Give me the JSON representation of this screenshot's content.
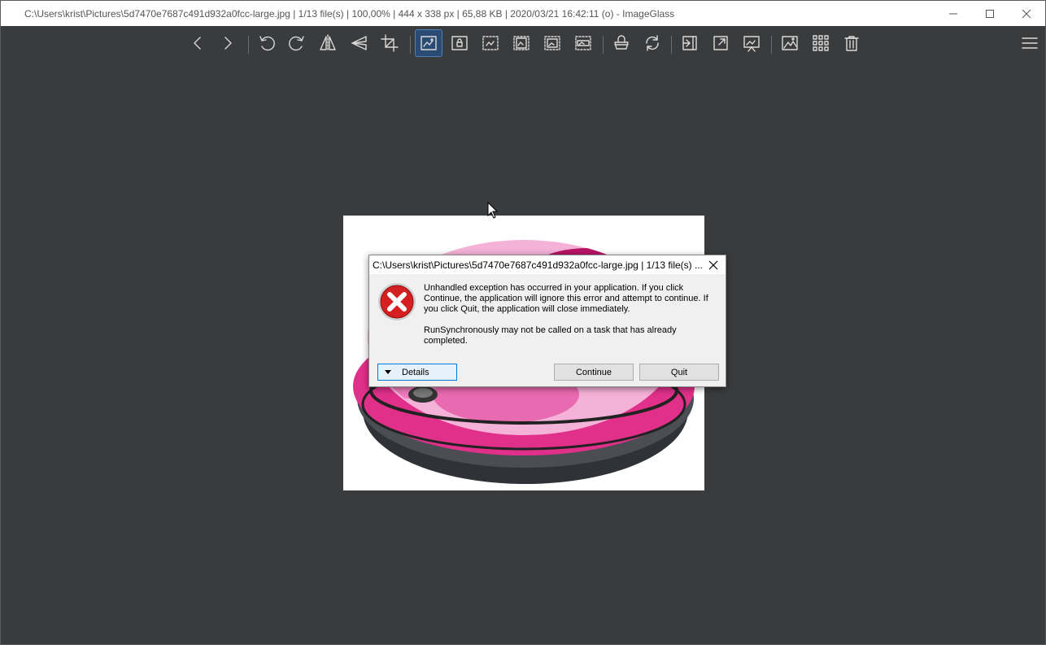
{
  "window": {
    "title": "C:\\Users\\krist\\Pictures\\5d7470e7687c491d932a0fcc-large.jpg  |  1/13 file(s)  |  100,00%  |  444 x 338 px  |  65,88 KB  |  2020/03/21 16:42:11 (o)  - ImageGlass"
  },
  "toolbar": {
    "buttons": [
      {
        "name": "previous-image",
        "icon": "chevron-left-icon"
      },
      {
        "name": "next-image",
        "icon": "chevron-right-icon"
      },
      {
        "name": "rotate-left",
        "icon": "rotate-left-icon"
      },
      {
        "name": "rotate-right",
        "icon": "rotate-right-icon"
      },
      {
        "name": "flip-horizontal",
        "icon": "flip-horizontal-icon"
      },
      {
        "name": "flip-vertical",
        "icon": "flip-vertical-icon"
      },
      {
        "name": "crop",
        "icon": "crop-icon"
      },
      {
        "name": "auto-zoom",
        "icon": "auto-zoom-icon",
        "active": true
      },
      {
        "name": "lock-zoom",
        "icon": "lock-zoom-icon"
      },
      {
        "name": "scale-to-width",
        "icon": "scale-width-icon"
      },
      {
        "name": "scale-to-height",
        "icon": "scale-height-icon"
      },
      {
        "name": "scale-to-fit",
        "icon": "scale-fit-icon"
      },
      {
        "name": "scale-to-fill",
        "icon": "scale-fill-icon"
      },
      {
        "name": "open-with",
        "icon": "open-with-icon"
      },
      {
        "name": "refresh",
        "icon": "refresh-icon"
      },
      {
        "name": "goto",
        "icon": "goto-icon"
      },
      {
        "name": "fullscreen",
        "icon": "fullscreen-icon"
      },
      {
        "name": "slideshow",
        "icon": "slideshow-icon"
      },
      {
        "name": "set-wallpaper",
        "icon": "wallpaper-icon"
      },
      {
        "name": "thumbnails",
        "icon": "grid-icon"
      },
      {
        "name": "delete",
        "icon": "trash-icon"
      },
      {
        "name": "main-menu",
        "icon": "hamburger-menu-icon"
      }
    ]
  },
  "dialog": {
    "title": "C:\\Users\\krist\\Pictures\\5d7470e7687c491d932a0fcc-large.jpg  |  1/13 file(s) ...",
    "message": "Unhandled exception has occurred in your application. If you click Continue, the application will ignore this error and attempt to continue. If you click Quit, the application will close immediately.",
    "detail": "RunSynchronously may not be called on a task that has already completed.",
    "details_label": "Details",
    "continue_label": "Continue",
    "quit_label": "Quit",
    "icon": "error-icon"
  },
  "colors": {
    "background": "#3a3b3d",
    "accent_active": "#2a4b73",
    "error_red": "#d42020",
    "camo_pink": "#e0308a"
  }
}
